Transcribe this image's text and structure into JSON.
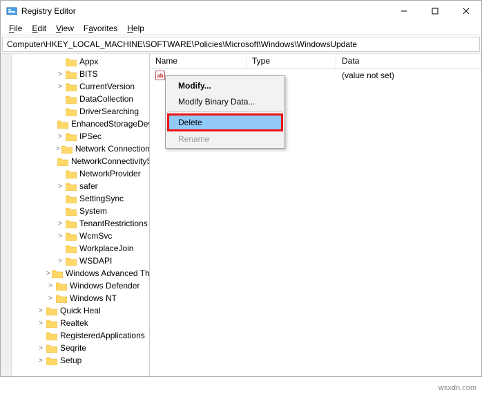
{
  "window": {
    "title": "Registry Editor"
  },
  "menu": {
    "file": "File",
    "edit": "Edit",
    "view": "View",
    "favorites": "Favorites",
    "help": "Help"
  },
  "address": "Computer\\HKEY_LOCAL_MACHINE\\SOFTWARE\\Policies\\Microsoft\\Windows\\WindowsUpdate",
  "tree": {
    "items": [
      {
        "label": "Appx",
        "indent": 2,
        "exp": ""
      },
      {
        "label": "BITS",
        "indent": 2,
        "exp": ">"
      },
      {
        "label": "CurrentVersion",
        "indent": 2,
        "exp": ">"
      },
      {
        "label": "DataCollection",
        "indent": 2,
        "exp": ""
      },
      {
        "label": "DriverSearching",
        "indent": 2,
        "exp": ""
      },
      {
        "label": "EnhancedStorageDevices",
        "indent": 2,
        "exp": ""
      },
      {
        "label": "IPSec",
        "indent": 2,
        "exp": ">"
      },
      {
        "label": "Network Connections",
        "indent": 2,
        "exp": ">"
      },
      {
        "label": "NetworkConnectivityStatusIndicator",
        "indent": 2,
        "exp": ""
      },
      {
        "label": "NetworkProvider",
        "indent": 2,
        "exp": ""
      },
      {
        "label": "safer",
        "indent": 2,
        "exp": ">"
      },
      {
        "label": "SettingSync",
        "indent": 2,
        "exp": ""
      },
      {
        "label": "System",
        "indent": 2,
        "exp": ""
      },
      {
        "label": "TenantRestrictions",
        "indent": 2,
        "exp": ">"
      },
      {
        "label": "WcmSvc",
        "indent": 2,
        "exp": ">"
      },
      {
        "label": "WorkplaceJoin",
        "indent": 2,
        "exp": ""
      },
      {
        "label": "WSDAPI",
        "indent": 2,
        "exp": ">"
      },
      {
        "label": "Windows Advanced Threat Protection",
        "indent": 1,
        "exp": ">"
      },
      {
        "label": "Windows Defender",
        "indent": 1,
        "exp": ">"
      },
      {
        "label": "Windows NT",
        "indent": 1,
        "exp": ">"
      },
      {
        "label": "Quick Heal",
        "indent": 0,
        "exp": ">"
      },
      {
        "label": "Realtek",
        "indent": 0,
        "exp": ">"
      },
      {
        "label": "RegisteredApplications",
        "indent": 0,
        "exp": ""
      },
      {
        "label": "Seqrite",
        "indent": 0,
        "exp": ">"
      },
      {
        "label": "Setup",
        "indent": 0,
        "exp": ">"
      }
    ]
  },
  "columns": {
    "name": "Name",
    "type": "Type",
    "data": "Data"
  },
  "row": {
    "data": "(value not set)"
  },
  "ctx": {
    "modify": "Modify...",
    "modify_binary": "Modify Binary Data...",
    "delete": "Delete",
    "rename": "Rename"
  },
  "watermark": "wsxdn.com"
}
